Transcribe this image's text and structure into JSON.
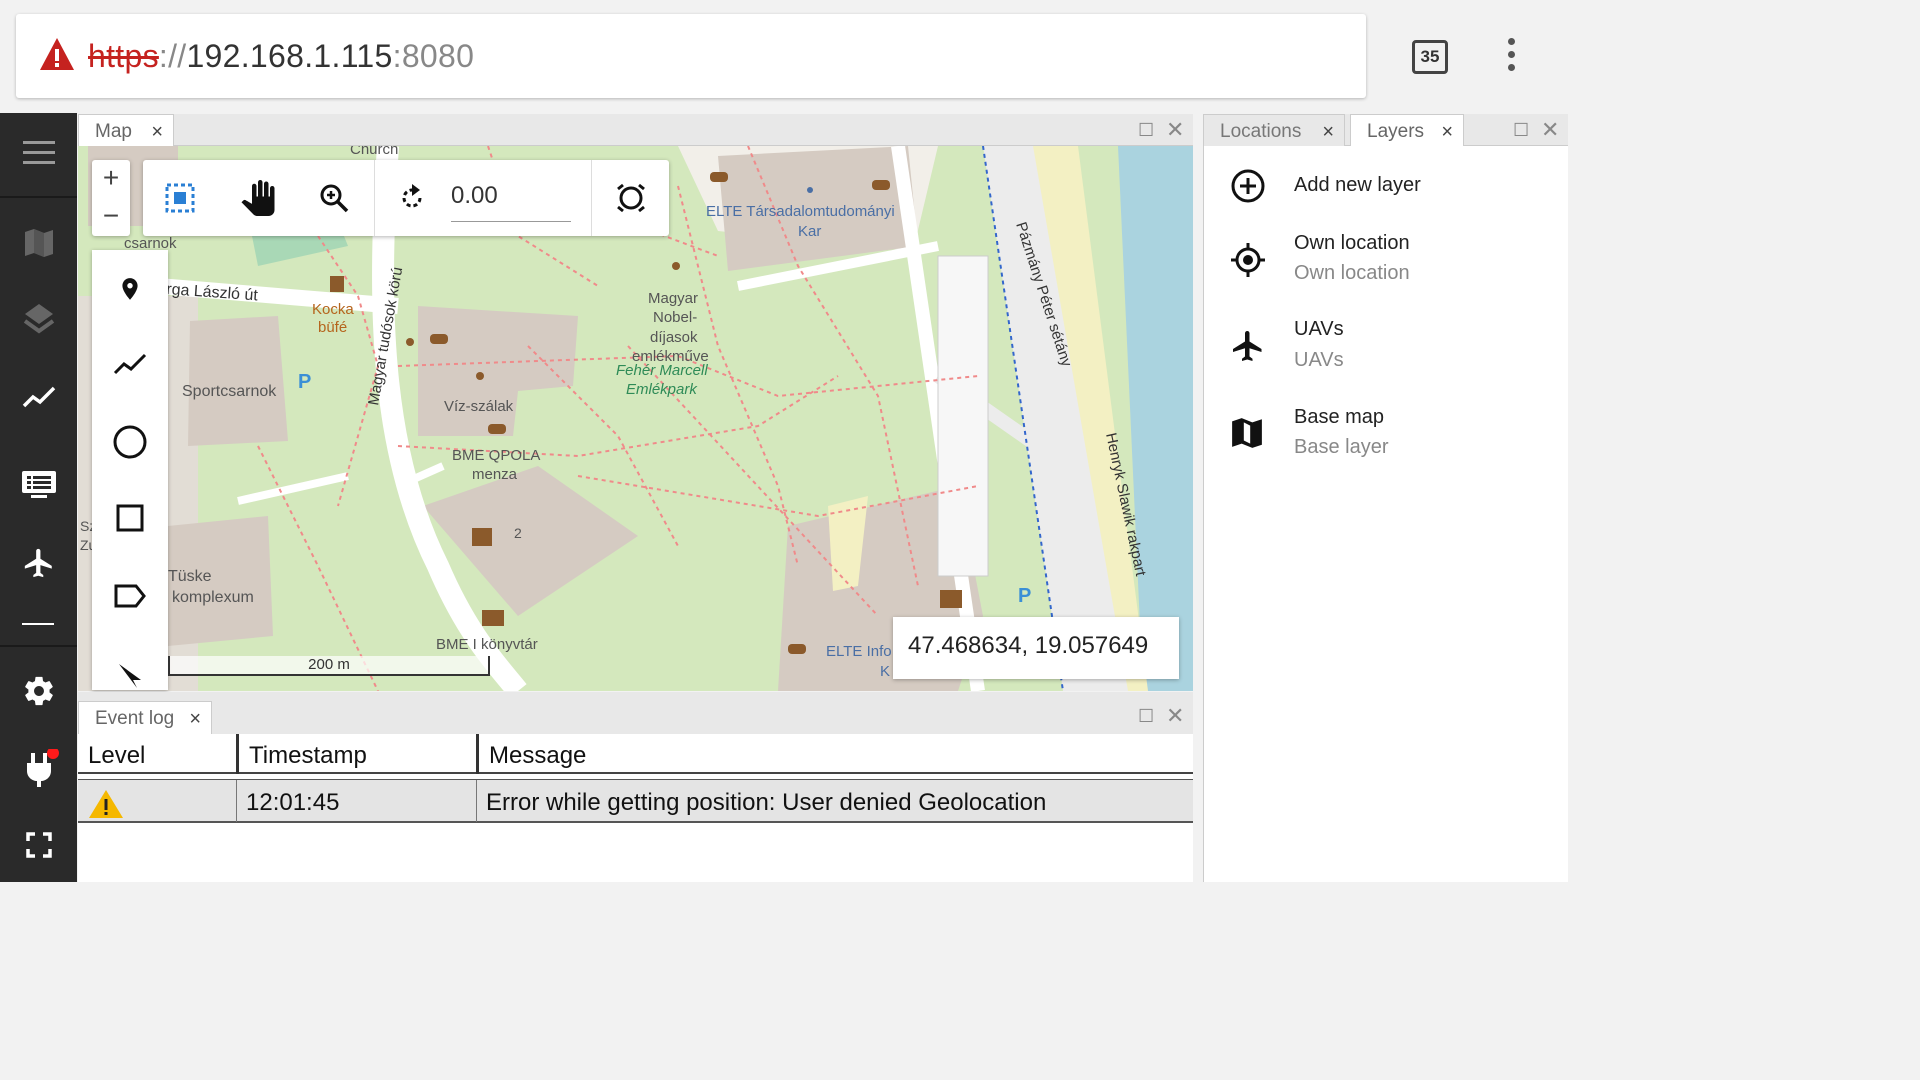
{
  "browser": {
    "url_scheme": "https",
    "url_separator": "://",
    "url_host": "192.168.1.115",
    "url_port": ":8080",
    "tab_count": "35",
    "warning_icon": "warning-triangle-icon",
    "menu_icon": "kebab-menu-icon"
  },
  "sidebar": {
    "items": [
      {
        "icon": "hamburger-menu-icon"
      },
      {
        "icon": "map-icon"
      },
      {
        "icon": "layers-icon"
      },
      {
        "icon": "chart-line-icon"
      },
      {
        "icon": "event-log-icon"
      },
      {
        "icon": "airplane-icon"
      },
      {
        "icon": "settings-icon"
      },
      {
        "icon": "plug-icon",
        "badge_color": "#ff1a1a"
      },
      {
        "icon": "fullscreen-icon"
      }
    ]
  },
  "map_panel": {
    "tab_label": "Map",
    "close": "×",
    "zoom_in": "+",
    "zoom_out": "−",
    "rotation_value": "0.00",
    "scale_label": "200 m",
    "coordinates": "47.468634, 19.057649",
    "tools": [
      "select-box-icon",
      "pan-hand-icon",
      "zoom-icon",
      "rotate-icon",
      "reset-rotation-icon"
    ],
    "draw_tools": [
      "marker-icon",
      "polyline-icon",
      "circle-icon",
      "rectangle-icon",
      "label-icon",
      "pointer-icon"
    ],
    "labels": {
      "church": "Church",
      "csarnok": "csarnok",
      "street1": "rga László út",
      "kocka": "Kocka",
      "bufe": "büfé",
      "magyar_tudosok": "Magyar tudósok körú",
      "sportcsarnok": "Sportcsarnok",
      "parking": "P",
      "vizszalak": "Víz-szálak",
      "bme_qpola": "BME QPOLA",
      "menza": "menza",
      "magyar_nobel": [
        "Magyar",
        "Nobel-",
        "díjasok",
        "emlékműve"
      ],
      "feher": "Fehér Marcell",
      "emlekpark": "Emlékpark",
      "elte1": "ELTE Társadalomtudományi",
      "kar": "Kar",
      "pazmany": "Pázmány Péter sétány",
      "henryk": "Henryk Slawik rakpart",
      "tuske": "Tüske",
      "komplexum": "komplexum",
      "bme_konyvtar": "BME I könyvtár",
      "elte_info": "ELTE Info",
      "two": "2",
      "sz": "Sz",
      "zu": "Zu",
      "ka": "K"
    }
  },
  "layers_panel": {
    "tab_locations": "Locations",
    "tab_layers": "Layers",
    "close": "×",
    "items": [
      {
        "icon": "add-circle-icon",
        "title": "Add new layer",
        "subtitle": ""
      },
      {
        "icon": "location-target-icon",
        "title": "Own location",
        "subtitle": "Own location"
      },
      {
        "icon": "airplane-icon",
        "title": "UAVs",
        "subtitle": "UAVs"
      },
      {
        "icon": "map-icon",
        "title": "Base map",
        "subtitle": "Base layer"
      }
    ]
  },
  "event_log": {
    "tab_label": "Event log",
    "close": "×",
    "columns": [
      "Level",
      "Timestamp",
      "Message"
    ],
    "rows": [
      {
        "level_icon": "warning-icon",
        "timestamp": "12:01:45",
        "message": "Error while getting position: User denied Geolocation"
      }
    ]
  },
  "colors": {
    "sidebar_bg": "#2a2a2a",
    "map_green": "#cde8b0",
    "building": "#d4c9c0",
    "water": "#aad3df",
    "warning_yellow": "#f5b800",
    "url_red": "#c5221f"
  }
}
